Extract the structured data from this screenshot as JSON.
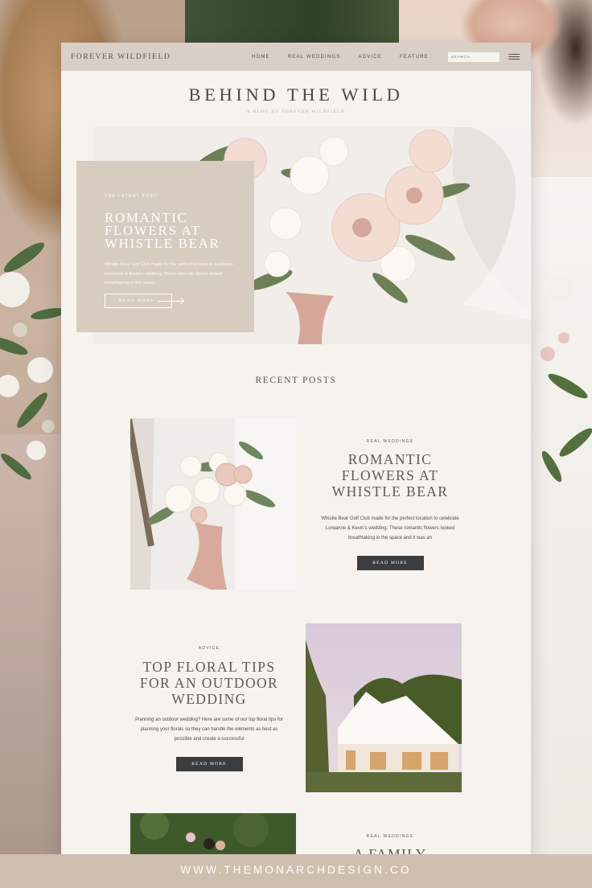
{
  "nav": {
    "brand": "FOREVER WILDFIELD",
    "links": [
      "HOME",
      "REAL WEDDINGS",
      "ADVICE",
      "FEATURE"
    ],
    "search_placeholder": "SEARCH",
    "menu_icon": "hamburger-menu-icon"
  },
  "header": {
    "title": "BEHIND THE WILD",
    "subtitle": "A BLOG BY FOREVER WILDFIELD"
  },
  "hero": {
    "tag": "THE LATEST POST",
    "title": "ROMANTIC FLOWERS AT WHISTLE BEAR",
    "excerpt": "Whistle Bear Golf Club made for the perfect location to celebrate Loreanne & Kevin's wedding. These romantic florals looked breathtaking in the space",
    "button": "READ MORE",
    "arrow_icon": "arrow-right-icon"
  },
  "recent_heading": "RECENT POSTS",
  "posts": [
    {
      "category": "REAL WEDDINGS",
      "title": "ROMANTIC FLOWERS AT WHISTLE BEAR",
      "excerpt": "Whistle Bear Golf Club made for the perfect location to celebrate Loreanne & Kevin's wedding. These romantic flowers looked breathtaking in the space and it was an",
      "button": "READ MORE"
    },
    {
      "category": "ADVICE",
      "title": "TOP FLORAL TIPS FOR AN OUTDOOR WEDDING",
      "excerpt": "Planning an outdoor wedding? Here are some of our top floral tips for planning your florals so they can handle the elements as best as possible and create a successful",
      "button": "READ MORE"
    },
    {
      "category": "REAL WEDDINGS",
      "title": "A FAMILY"
    }
  ],
  "footer": "WWW.THEMONARCHDESIGN.CO",
  "colors": {
    "nav_bg": "#d9cfc6",
    "page_bg": "#f6f3ef",
    "hero_card": "#d8cbc0",
    "button_dark": "#3c3d3e",
    "footer_bg": "#cfbfb1"
  }
}
